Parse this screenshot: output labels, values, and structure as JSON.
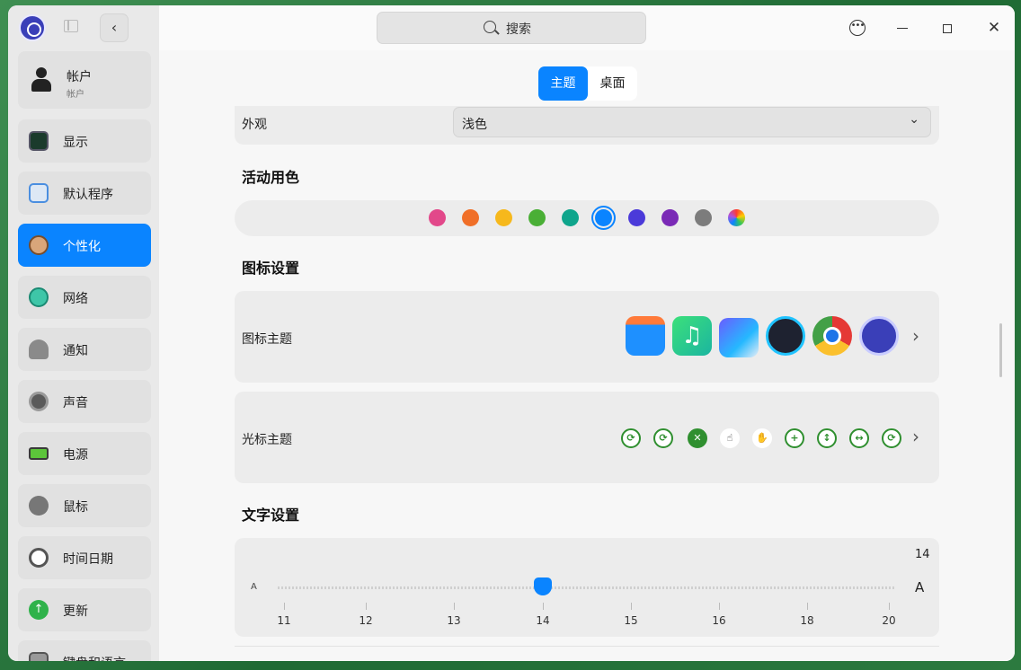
{
  "app": {
    "logo_icon": "deepin-settings-logo-icon"
  },
  "search": {
    "label": "搜索"
  },
  "sidebar": {
    "account": {
      "title": "帐户",
      "subtitle": "帐户"
    },
    "items": [
      {
        "label": "显示",
        "icon": "monitor-icon"
      },
      {
        "label": "默认程序",
        "icon": "default-apps-icon"
      },
      {
        "label": "个性化",
        "icon": "palette-icon"
      },
      {
        "label": "网络",
        "icon": "network-globe-icon"
      },
      {
        "label": "通知",
        "icon": "bell-icon"
      },
      {
        "label": "声音",
        "icon": "speaker-icon"
      },
      {
        "label": "电源",
        "icon": "battery-icon"
      },
      {
        "label": "鼠标",
        "icon": "mouse-icon"
      },
      {
        "label": "时间日期",
        "icon": "clock-icon"
      },
      {
        "label": "更新",
        "icon": "update-arrow-icon"
      },
      {
        "label": "键盘和语言",
        "icon": "keyboard-icon"
      }
    ]
  },
  "tabs": [
    {
      "label": "主题"
    },
    {
      "label": "桌面"
    }
  ],
  "appearance": {
    "label": "外观",
    "value": "浅色"
  },
  "accent": {
    "title": "活动用色",
    "colors": [
      "#e2488a",
      "#f06f28",
      "#f6b81c",
      "#4aaf36",
      "#0fa58c",
      "#0a84ff",
      "#4b3ad9",
      "#7a2ab6",
      "#7c7c7c",
      "multicolor"
    ],
    "selected_index": 5
  },
  "icon_settings": {
    "title": "图标设置",
    "icon_theme_label": "图标主题",
    "icon_theme_preview": [
      "file-manager-icon",
      "music-icon",
      "image-viewer-icon",
      "video-player-icon",
      "chrome-icon",
      "control-center-icon"
    ],
    "cursor_theme_label": "光标主题",
    "cursor_theme_preview": [
      "arrow-cursor-icon",
      "busy-cursor-icon",
      "not-allowed-cursor-icon",
      "pointer-hand-cursor-icon",
      "grab-hand-cursor-icon",
      "move-cursor-icon",
      "resize-vertical-cursor-icon",
      "resize-horizontal-cursor-icon",
      "spinner-cursor-icon"
    ]
  },
  "text_settings": {
    "title": "文字设置",
    "size_value": "14",
    "small_label": "A",
    "large_label": "A",
    "ticks": [
      "11",
      "12",
      "13",
      "14",
      "15",
      "16",
      "18",
      "20"
    ],
    "selected_tick_index": 3
  }
}
